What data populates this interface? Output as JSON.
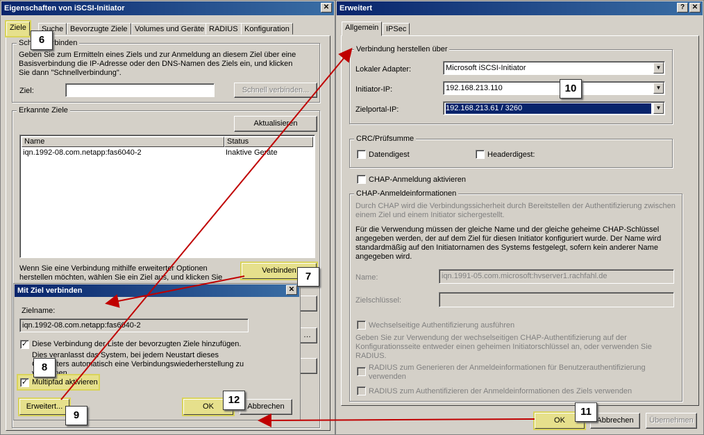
{
  "props_window": {
    "title": "Eigenschaften von iSCSI-Initiator",
    "close": "✕",
    "tabs": [
      "Ziele",
      "Suche",
      "Bevorzugte Ziele",
      "Volumes und Geräte",
      "RADIUS",
      "Konfiguration"
    ],
    "quick": {
      "legend": "Schnellverbinden",
      "desc": "Geben Sie zum Ermitteln eines Ziels und zur Anmeldung an diesem Ziel über eine Basisverbindung die IP-Adresse oder den DNS-Namen des Ziels ein, und klicken Sie dann \"Schnellverbindung\".",
      "target_label": "Ziel:",
      "target_value": "",
      "quick_button": "Schnell verbinden..."
    },
    "found": {
      "legend": "Erkannte Ziele",
      "refresh_button": "Aktualisieren",
      "columns": [
        "Name",
        "Status"
      ],
      "rows": [
        {
          "name": "iqn.1992-08.com.netapp:fas6040-2",
          "status": "Inaktive Geräte"
        }
      ],
      "adv_text": "Wenn Sie eine Verbindung mithilfe erweiterter Optionen herstellen möchten, wählen Sie ein Ziel aus, und klicken Sie",
      "connect_button": "Verbinden"
    }
  },
  "connect_dialog": {
    "title": "Mit Ziel verbinden",
    "close": "✕",
    "name_label": "Zielname:",
    "name_value": "iqn.1992-08.com.netapp:fas6040-2",
    "add_fav_label": "Diese Verbindung der Liste der bevorzugten Ziele hinzufügen.",
    "add_fav_desc": "Dies veranlasst das System, bei jedem Neustart dieses Computers automatisch eine Verbindungswiederherstellung zu versuchen.",
    "multipath_label": "Multipfad aktivieren",
    "advanced_button": "Erweitert...",
    "ok_button": "OK",
    "cancel_button": "Abbrechen"
  },
  "adv_window": {
    "title": "Erweitert",
    "help": "?",
    "close": "✕",
    "tabs": [
      "Allgemein",
      "IPSec"
    ],
    "connect_group": {
      "legend": "Verbindung herstellen über",
      "adapter_label": "Lokaler Adapter:",
      "adapter_value": "Microsoft iSCSI-Initiator",
      "ip_label": "Initiator-IP:",
      "ip_value": "192.168.213.110",
      "portal_label": "Zielportal-IP:",
      "portal_value": "192.168.213.61 / 3260"
    },
    "crc_group": {
      "legend": "CRC/Prüfsumme",
      "data_digest": "Datendigest",
      "header_digest": "Headerdigest:"
    },
    "chap_enable": "CHAP-Anmeldung aktivieren",
    "chap_group": {
      "legend": "CHAP-Anmeldeinformationen",
      "desc1": "Durch CHAP wird die Verbindungssicherheit durch Bereitstellen der Authentifizierung zwischen einem Ziel und einem Initiator sichergestellt.",
      "desc2": "Für die Verwendung müssen der gleiche Name und der gleiche geheime CHAP-Schlüssel angegeben werden, der auf dem Ziel für diesen Initiator konfiguriert wurde. Der Name wird standardmäßig auf den Initiatornamen des Systems festgelegt, sofern kein anderer Name angegeben wird.",
      "name_label": "Name:",
      "name_value": "iqn.1991-05.com.microsoft:hvserver1.rachfahl.de",
      "secret_label": "Zielschlüssel:",
      "mutual_label": "Wechselseitige Authentifizierung ausführen",
      "mutual_desc": "Geben Sie zur Verwendung der wechselseitigen CHAP-Authentifizierung auf der Konfigurationsseite entweder einen geheimen Initiatorschlüssel an, oder verwenden Sie RADIUS.",
      "radius1": "RADIUS zum Generieren der Anmeldeinformationen für Benutzerauthentifizierung verwenden",
      "radius2": "RADIUS zum Authentifizieren der Anmeldeinformationen des Ziels verwenden"
    },
    "ok_button": "OK",
    "cancel_button": "Abbrechen",
    "apply_button": "Übernehmen"
  },
  "callouts": [
    "6",
    "7",
    "8",
    "9",
    "10",
    "11",
    "12"
  ],
  "colors": {
    "title_start": "#08246b",
    "title_end": "#3a6ea5",
    "arrow": "#c00000",
    "highlight": "#e6e08c"
  }
}
